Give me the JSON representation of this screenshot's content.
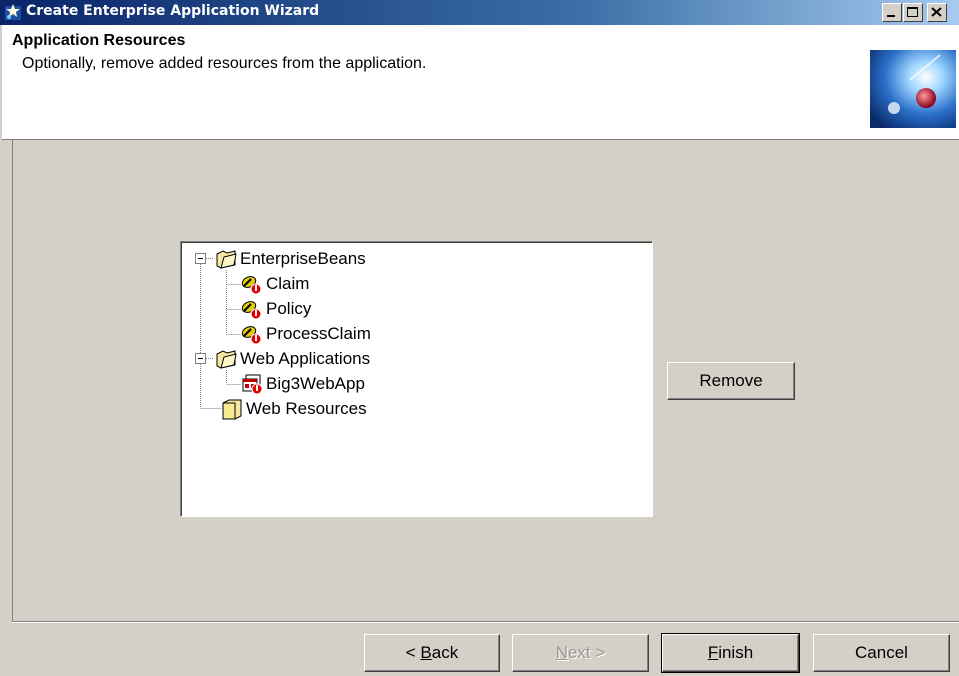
{
  "window": {
    "title": "Create Enterprise Application Wizard",
    "controls": [
      "minimize-icon",
      "maximize-icon",
      "close-icon"
    ]
  },
  "header": {
    "title": "Application Resources",
    "subtitle": "Optionally, remove added resources from the application."
  },
  "tree": {
    "items": [
      {
        "label": "EnterpriseBeans",
        "icon": "folder-open-icon",
        "expanded": true
      },
      {
        "label": "Claim",
        "icon": "ejb-bean-icon"
      },
      {
        "label": "Policy",
        "icon": "ejb-bean-icon"
      },
      {
        "label": "ProcessClaim",
        "icon": "ejb-bean-icon"
      },
      {
        "label": "Web Applications",
        "icon": "folder-open-icon",
        "expanded": true
      },
      {
        "label": "Big3WebApp",
        "icon": "web-app-icon"
      },
      {
        "label": "Web Resources",
        "icon": "folder-closed-icon"
      }
    ]
  },
  "buttons": {
    "remove": "Remove",
    "back_prefix": "< ",
    "back_mnemonic": "B",
    "back_rest": "ack",
    "next_prefix": "",
    "next_mnemonic": "N",
    "next_rest": "ext >",
    "finish_prefix": "",
    "finish_mnemonic": "F",
    "finish_rest": "inish",
    "cancel": "Cancel"
  },
  "colors": {
    "titlebar_start": "#0a246a",
    "titlebar_end": "#a6caf0",
    "dialog_bg": "#d4d0c8",
    "disabled_text": "#9a9890"
  }
}
